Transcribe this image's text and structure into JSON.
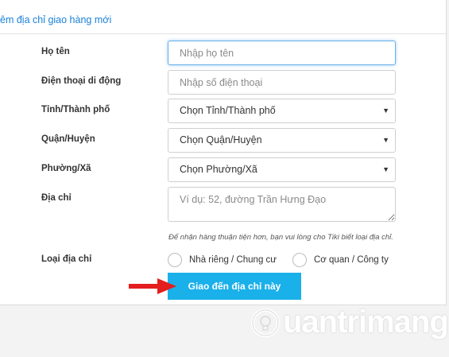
{
  "form": {
    "title": "êm địa chỉ giao hàng mới",
    "fields": {
      "name": {
        "label": "Họ tên",
        "placeholder": "Nhập họ tên"
      },
      "phone": {
        "label": "Điện thoại di động",
        "placeholder": "Nhập số điện thoại"
      },
      "province": {
        "label": "Tỉnh/Thành phố",
        "value": "Chọn Tỉnh/Thành phố"
      },
      "district": {
        "label": "Quận/Huyện",
        "value": "Chọn Quận/Huyện"
      },
      "ward": {
        "label": "Phường/Xã",
        "value": "Chọn Phường/Xã"
      },
      "address": {
        "label": "Địa chỉ",
        "placeholder": "Ví dụ: 52, đường Trần Hưng Đạo"
      }
    },
    "hint": "Để nhận hàng thuận tiện hơn, bạn vui lòng cho Tiki biết loại địa chỉ.",
    "address_type": {
      "label": "Loại địa chỉ",
      "options": [
        "Nhà riêng / Chung cư",
        "Cơ quan / Công ty"
      ]
    },
    "submit_label": "Giao đến địa chỉ này"
  },
  "watermark": {
    "text": "uantrimang"
  },
  "colors": {
    "accent": "#1ab0ea",
    "link": "#1a82d8",
    "arrow": "#e41e1e"
  }
}
